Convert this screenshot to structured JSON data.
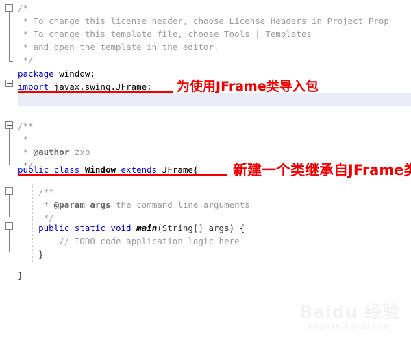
{
  "editor": {
    "language": "java",
    "theme_background": "#ffffff",
    "caret_line_color": "#e8edf7",
    "keyword_color": "#0000cc",
    "comment_color": "#9a9a9a",
    "annotation_color": "#f20000",
    "lines": [
      {
        "id": "l1",
        "text": "/*"
      },
      {
        "id": "l2",
        "text": " * To change this license header, choose License Headers in Project Prop"
      },
      {
        "id": "l3",
        "text": " * To change this template file, choose Tools | Templates"
      },
      {
        "id": "l4",
        "text": " * and open the template in the editor."
      },
      {
        "id": "l5",
        "text": " */"
      },
      {
        "id": "l6",
        "text": ""
      },
      {
        "id": "l7",
        "text": "package window;"
      },
      {
        "id": "l8",
        "text": "import javax.swing.JFrame;"
      },
      {
        "id": "l9",
        "text": ""
      },
      {
        "id": "l10",
        "text": ""
      },
      {
        "id": "l11",
        "text": "/**"
      },
      {
        "id": "l12",
        "text": " *"
      },
      {
        "id": "l13",
        "text": " * @author zxb"
      },
      {
        "id": "l14",
        "text": " */"
      },
      {
        "id": "l15",
        "text": "public class Window extends JFrame{"
      },
      {
        "id": "l16",
        "text": ""
      },
      {
        "id": "l17",
        "text": "    /**"
      },
      {
        "id": "l18",
        "text": "     * @param args the command line arguments"
      },
      {
        "id": "l19",
        "text": "     */"
      },
      {
        "id": "l20",
        "text": "    public static void main(String[] args) {"
      },
      {
        "id": "l21",
        "text": "        // TODO code application logic here"
      },
      {
        "id": "l22",
        "text": "    }"
      },
      {
        "id": "l23",
        "text": ""
      },
      {
        "id": "l24",
        "text": "}"
      }
    ],
    "tokens": {
      "comment_open_1": "/*",
      "comment_line_license": " * To change this license header, choose License Headers in Project Prop",
      "comment_line_template": " * To change this template file, choose Tools | Templates",
      "comment_line_open": " * and open the template in the editor.",
      "comment_close_1": " */",
      "kw_package": "package",
      "pkg_name": " window;",
      "kw_import": "import",
      "import_name": " javax.swing.JFrame;",
      "javadoc_open": "/**",
      "javadoc_star": " *",
      "javadoc_star_author": " * ",
      "tag_author": "@author",
      "author_name": " zxb",
      "javadoc_close": " */",
      "kw_public": "public",
      "kw_class": " class ",
      "class_name": "Window",
      "kw_extends": " extends ",
      "super_name": "JFrame{",
      "javadoc_open_indent": "    /**",
      "javadoc_star_param": "     * ",
      "tag_param": "@param args",
      "param_desc": " the command line arguments",
      "javadoc_close_indent": "     */",
      "kw_public_2": "    public",
      "kw_static": " static ",
      "kw_void": "void ",
      "method_name": "main",
      "method_sig": "(String[] args) {",
      "todo_comment": "        // TODO code application logic here",
      "brace_close_inner": "    }",
      "brace_close_outer": "}"
    }
  },
  "annotations": {
    "import_note": "为使用JFrame类导入包",
    "class_note": "新建一个类继承自JFrame类"
  },
  "watermark": {
    "main": "Baidu 经验",
    "sub": "jingyan.baidu.com"
  }
}
